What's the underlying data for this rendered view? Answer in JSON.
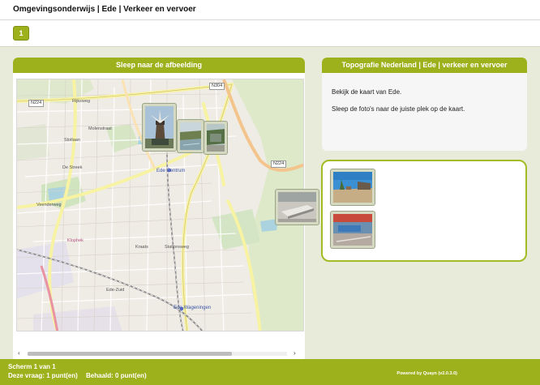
{
  "header": {
    "title": "Omgevingsonderwijs | Ede | Verkeer en vervoer"
  },
  "nav": {
    "page_button": "1"
  },
  "left_panel": {
    "title": "Sleep naar de afbeelding",
    "map_labels": {
      "rijksweg": "Rijksweg",
      "n224": "N224",
      "n304": "N304",
      "n224b": "N224",
      "slotlaan": "Slotlaan",
      "molenstraat": "Molenstraat",
      "veenderweg": "Veenderweg",
      "de_streek": "De Streek",
      "ede_centrum": "Ede Centrum",
      "kraats": "Kraats",
      "klophek": "Klophek",
      "stationsweg": "Stationsweg",
      "ede_zuid": "Ede-Zuid",
      "ede_wageningen": "Ede-Wageningen"
    },
    "scroll": {
      "left_arrow": "‹",
      "right_arrow": "›"
    }
  },
  "right_panel": {
    "title": "Topografie Nederland | Ede | verkeer en vervoer",
    "instruction_1": "Bekijk de kaart van Ede.",
    "instruction_2": "Sleep de foto's naar de juiste plek op de kaart."
  },
  "photos": [
    {
      "name": "windmill",
      "subject": "windmill-photo"
    },
    {
      "name": "pond",
      "subject": "pond-photo"
    },
    {
      "name": "building",
      "subject": "building-photo"
    },
    {
      "name": "bench",
      "subject": "bench-photo"
    },
    {
      "name": "square",
      "subject": "square-photo"
    },
    {
      "name": "station",
      "subject": "station-photo"
    }
  ],
  "footer": {
    "screen": "Scherm 1 van 1",
    "question_points": "Deze vraag: 1 punt(en)",
    "achieved": "Behaald: 0 punt(en)",
    "powered": "Powered by Quayn (v2.0.3.0)"
  },
  "colors": {
    "accent": "#9db11d",
    "background": "#e8ebd9",
    "dropzone_border": "#a4bb24"
  }
}
